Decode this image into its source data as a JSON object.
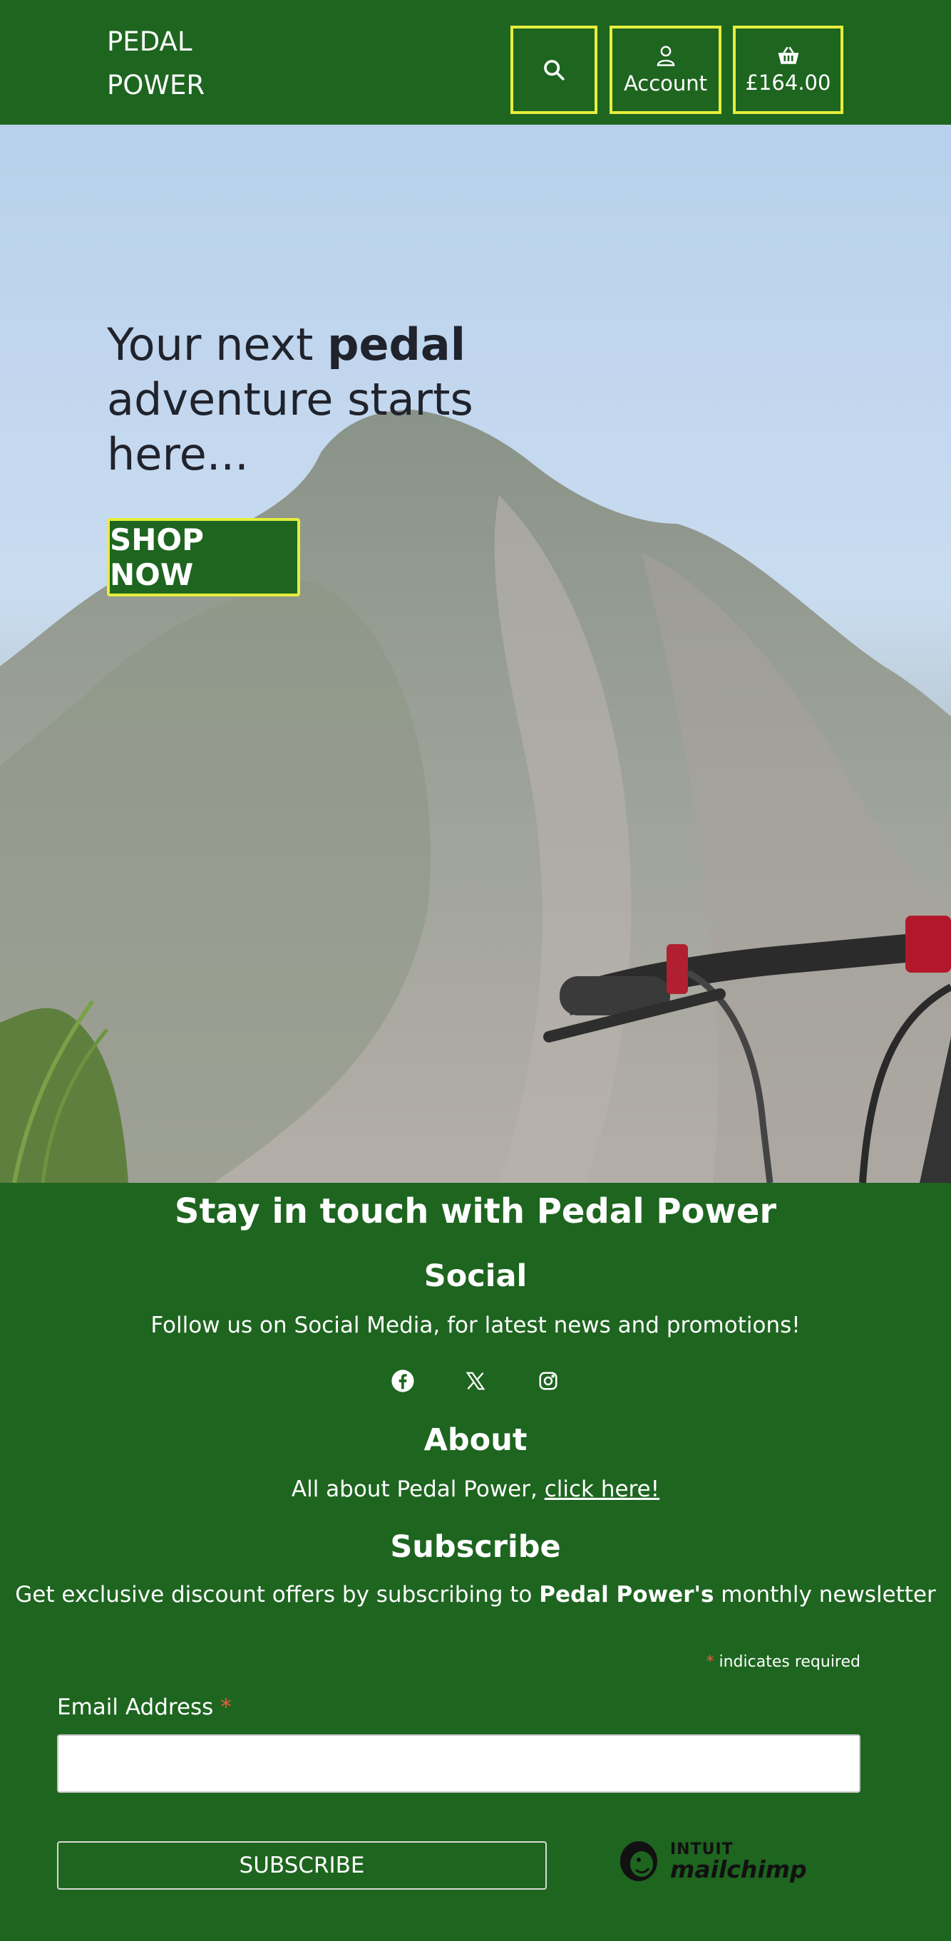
{
  "header": {
    "brand_line1": "PEDAL",
    "brand_line2": "POWER",
    "search_icon": "search-icon",
    "account_label": "Account",
    "account_icon": "user-icon",
    "basket_total": "£164.00",
    "basket_icon": "basket-icon"
  },
  "hero": {
    "title_part1": "Your next ",
    "title_bold": "pedal",
    "title_part2": " adventure starts here...",
    "cta_label": "SHOP NOW"
  },
  "newsletter": {
    "heading": "Stay in touch with Pedal Power",
    "social_heading": "Social",
    "social_text": "Follow us on Social Media, for latest news and promotions!",
    "social_icons": [
      "facebook-icon",
      "x-icon",
      "instagram-icon"
    ],
    "about_heading": "About",
    "about_text": "All about Pedal Power, ",
    "about_link": "click here!",
    "subscribe_heading": "Subscribe",
    "subscribe_text_1": "Get exclusive discount offers by subscribing to ",
    "subscribe_text_bold": "Pedal Power's",
    "subscribe_text_2": " monthly newsletter"
  },
  "form": {
    "required_star": "*",
    "required_note": " indicates required",
    "email_label": "Email Address",
    "email_value": "",
    "submit_label": "SUBSCRIBE"
  },
  "badge": {
    "intuit": "INTUIT",
    "mailchimp": "mailchimp"
  },
  "colors": {
    "brand_green": "#1e6520",
    "accent_yellow": "#e6ee3c",
    "required_red": "#e85c41",
    "hero_text": "#20232c"
  }
}
